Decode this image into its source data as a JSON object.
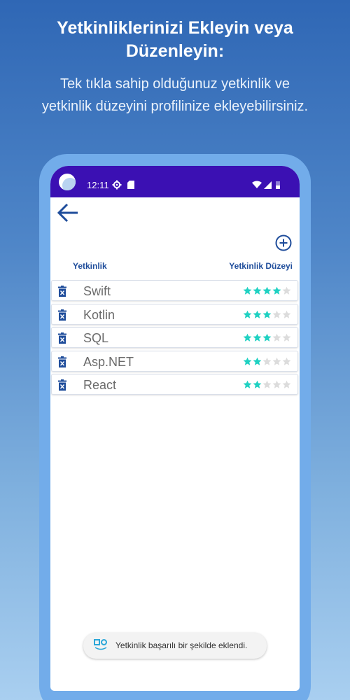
{
  "header": {
    "title": "Yetkinliklerinizi Ekleyin veya Düzenleyin:",
    "subtitle": "Tek tıkla sahip olduğunuz yetkinlik ve yetkinlik düzeyini profilinize ekleyebilirsiniz."
  },
  "status_bar": {
    "time": "12:11"
  },
  "table": {
    "col_skill": "Yetkinlik",
    "col_level": "Yetkinlik Düzeyi",
    "max_stars": 5,
    "rows": [
      {
        "name": "Swift",
        "rating": 4
      },
      {
        "name": "Kotlin",
        "rating": 3
      },
      {
        "name": "SQL",
        "rating": 3
      },
      {
        "name": "Asp.NET",
        "rating": 2
      },
      {
        "name": "React",
        "rating": 2
      }
    ]
  },
  "toast": {
    "message": "Yetkinlik başarılı bir şekilde eklendi."
  },
  "colors": {
    "status_bar": "#3b10b3",
    "accent": "#1f4d9b",
    "star_filled": "#1fd1c2",
    "star_empty": "#dcdcdc",
    "trash": "#1f4d9b"
  }
}
